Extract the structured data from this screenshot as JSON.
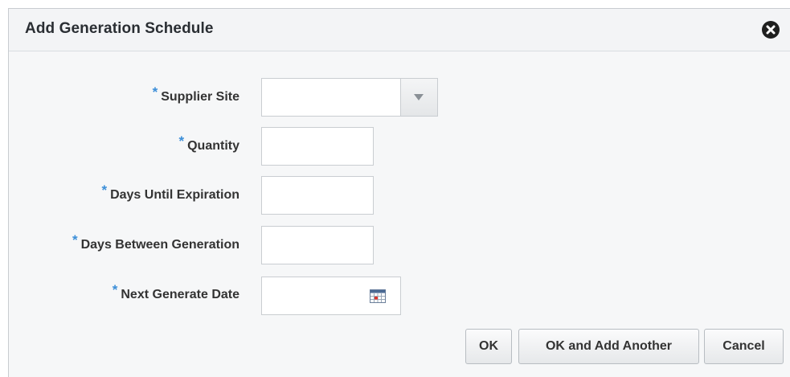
{
  "dialog": {
    "title": "Add Generation Schedule",
    "close_icon": "close-circle-icon"
  },
  "form": {
    "required_marker": "*",
    "supplier_site": {
      "label": "Supplier Site",
      "value": ""
    },
    "quantity": {
      "label": "Quantity",
      "value": ""
    },
    "days_until_expiration": {
      "label": "Days Until Expiration",
      "value": ""
    },
    "days_between_generation": {
      "label": "Days Between Generation",
      "value": ""
    },
    "next_generate_date": {
      "label": "Next Generate Date",
      "value": ""
    }
  },
  "buttons": {
    "ok": "OK",
    "ok_and_add_another": "OK and Add Another",
    "cancel": "Cancel"
  },
  "colors": {
    "required_marker": "#3b8ed8",
    "header_background": "#f3f4f6",
    "dialog_background": "#f6f7f8"
  }
}
